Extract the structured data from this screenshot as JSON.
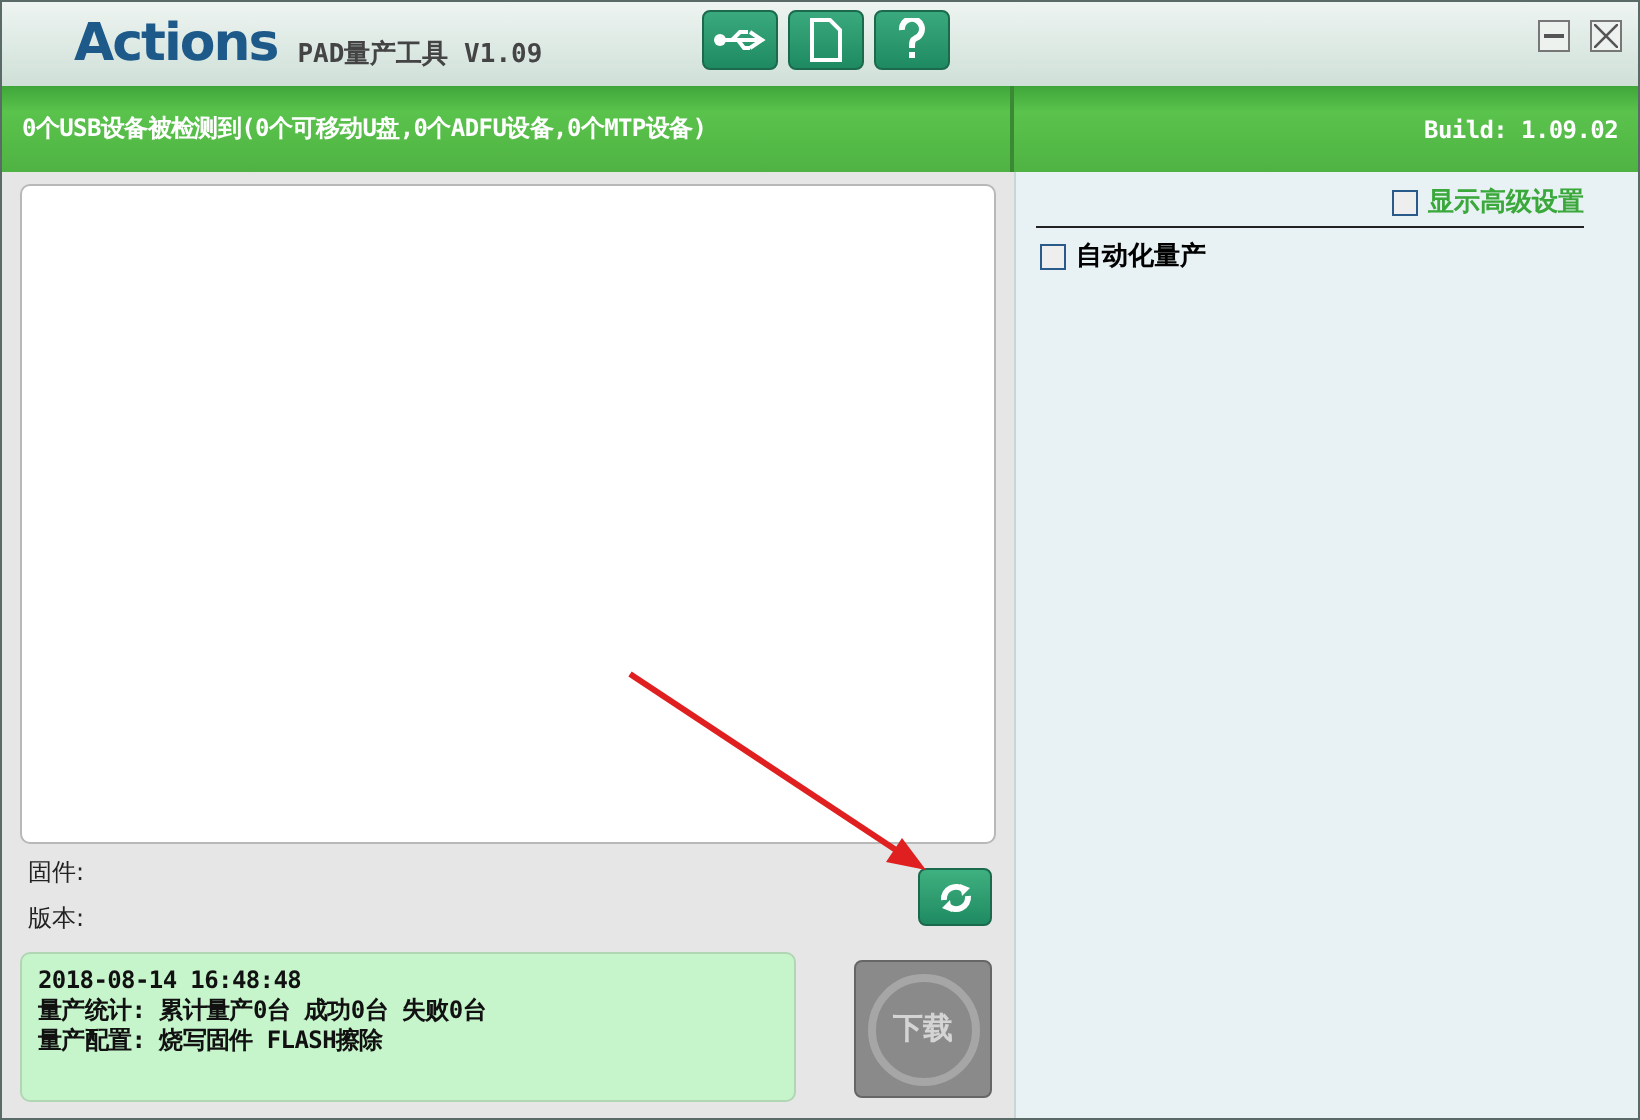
{
  "window": {
    "logo": "Actions",
    "title": "PAD量产工具 V1.09"
  },
  "status_bar": {
    "message": "0个USB设备被检测到(0个可移动U盘,0个ADFU设备,0个MTP设备)",
    "build": "Build: 1.09.02"
  },
  "firmware": {
    "firmware_label": "固件:",
    "version_label": "版本:"
  },
  "log": {
    "lines": [
      "2018-08-14 16:48:48",
      "量产统计: 累计量产0台 成功0台 失败0台",
      "量产配置: 烧写固件 FLASH擦除"
    ]
  },
  "download_button": {
    "label": "下载",
    "disabled": true
  },
  "settings": {
    "advanced": {
      "label": "显示高级设置",
      "checked": false
    },
    "options": [
      {
        "label": "自动化量产",
        "checked": false
      }
    ]
  }
}
